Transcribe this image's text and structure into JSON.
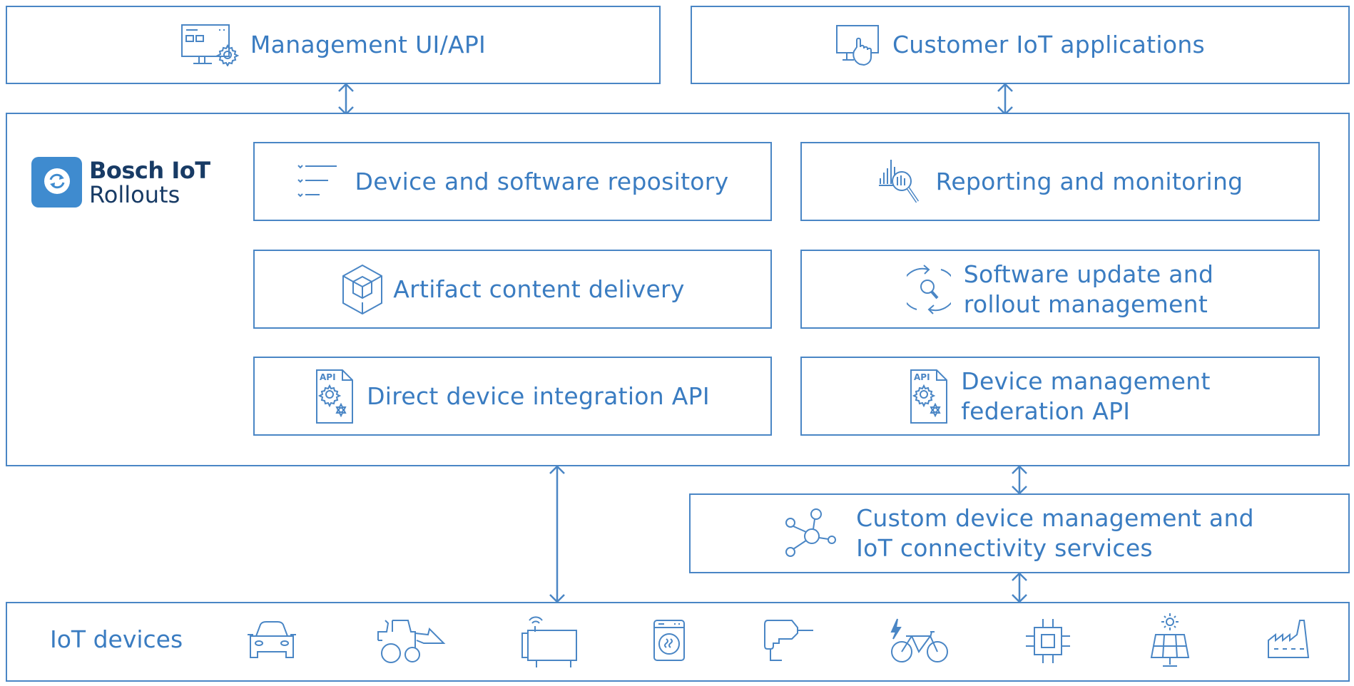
{
  "diagram": {
    "stroke_color": "#4a86c5",
    "text_color": "#3a7cc1",
    "top_boxes": [
      {
        "label": "Management UI/API",
        "icon": "monitor-gear-icon"
      },
      {
        "label": "Customer IoT applications",
        "icon": "touch-screen-icon"
      }
    ],
    "platform": {
      "logo": {
        "brand": "Bosch IoT",
        "product": "Rollouts",
        "icon": "sync-icon",
        "badge_color": "#3f8bcf",
        "text_color": "#183b65"
      },
      "services": [
        {
          "lines": [
            "Device and software repository"
          ],
          "icon": "checklist-icon"
        },
        {
          "lines": [
            "Reporting and monitoring"
          ],
          "icon": "chart-magnifier-icon"
        },
        {
          "lines": [
            "Artifact content delivery"
          ],
          "icon": "cube-icon"
        },
        {
          "lines": [
            "Software update and",
            "rollout management"
          ],
          "icon": "refresh-search-icon"
        },
        {
          "lines": [
            "Direct device integration API"
          ],
          "icon": "api-document-icon"
        },
        {
          "lines": [
            "Device management",
            "federation API"
          ],
          "icon": "api-document-icon"
        }
      ]
    },
    "connectivity": {
      "lines": [
        "Custom device management and",
        "IoT connectivity services"
      ],
      "icon": "network-nodes-icon"
    },
    "iot_devices": {
      "label": "IoT devices",
      "icons": [
        "car-icon",
        "tractor-loader-icon",
        "connected-box-icon",
        "washing-machine-icon",
        "drill-icon",
        "e-bike-icon",
        "chip-icon",
        "solar-panel-icon",
        "factory-icon"
      ]
    }
  }
}
